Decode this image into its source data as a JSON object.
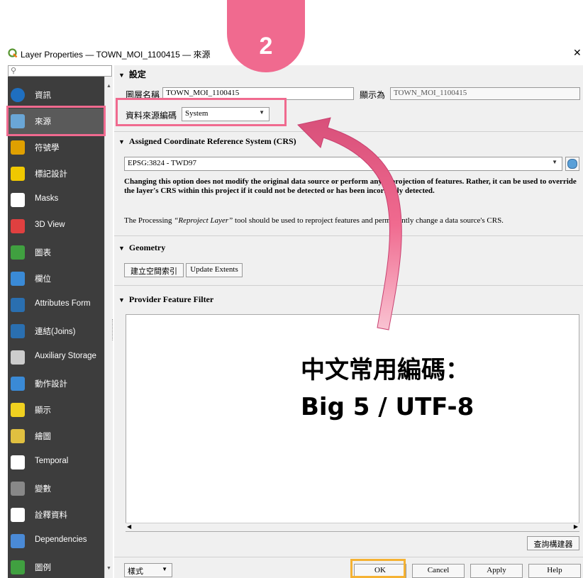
{
  "window": {
    "title": "Layer Properties — TOWN_MOI_1100415 — 來源",
    "close_glyph": "✕"
  },
  "sidebar": {
    "search_placeholder": "",
    "items": [
      {
        "label": "資訊",
        "icon": "info-icon",
        "color": "#1f6fc0"
      },
      {
        "label": "來源",
        "icon": "source-wrench-icon",
        "color": "#6aa6d6"
      },
      {
        "label": "符號學",
        "icon": "symbology-icon",
        "color": "#e0a000"
      },
      {
        "label": "標記設計",
        "icon": "labels-abc-icon",
        "color": "#f0c800"
      },
      {
        "label": "Masks",
        "icon": "masks-abc-icon",
        "color": "#ffffff"
      },
      {
        "label": "3D View",
        "icon": "cube-3d-icon",
        "color": "#e04040"
      },
      {
        "label": "圖表",
        "icon": "diagram-icon",
        "color": "#40a040"
      },
      {
        "label": "欄位",
        "icon": "fields-icon",
        "color": "#3a8ad6"
      },
      {
        "label": "Attributes Form",
        "icon": "form-icon",
        "color": "#2a6fb0"
      },
      {
        "label": "連結(Joins)",
        "icon": "joins-icon",
        "color": "#2a6fb0"
      },
      {
        "label": "Auxiliary Storage",
        "icon": "storage-icon",
        "color": "#cccccc"
      },
      {
        "label": "動作設計",
        "icon": "actions-gear-icon",
        "color": "#3a8ad6"
      },
      {
        "label": "顯示",
        "icon": "display-bubble-icon",
        "color": "#f0d020"
      },
      {
        "label": "繪圖",
        "icon": "rendering-brush-icon",
        "color": "#e0c040"
      },
      {
        "label": "Temporal",
        "icon": "clock-icon",
        "color": "#ffffff"
      },
      {
        "label": "變數",
        "icon": "variables-icon",
        "color": "#888888"
      },
      {
        "label": "詮釋資料",
        "icon": "metadata-icon",
        "color": "#ffffff"
      },
      {
        "label": "Dependencies",
        "icon": "dependencies-icon",
        "color": "#4a8ad6"
      },
      {
        "label": "圖例",
        "icon": "legend-icon",
        "color": "#40a040"
      }
    ]
  },
  "settings": {
    "header": "設定",
    "layer_name_label": "圖層名稱",
    "layer_name_value": "TOWN_MOI_1100415",
    "display_as_label": "顯示為",
    "display_as_value": "TOWN_MOI_1100415",
    "encoding_label": "資料來源編碼",
    "encoding_value": "System"
  },
  "crs": {
    "header": "Assigned Coordinate Reference System (CRS)",
    "value": "EPSG:3824 - TWD97",
    "warning": "Changing this option does not modify the original data source or perform any reprojection of features. Rather, it can be used to override the layer's CRS within this project if it could not be detected or has been incorrectly detected.",
    "note_prefix": "The Processing",
    "note_tool": "“Reproject Layer”",
    "note_suffix": "tool should be used to reproject features and permanently change a data source's CRS."
  },
  "geometry": {
    "header": "Geometry",
    "create_index_label": "建立空間索引",
    "update_extents_label": "Update Extents"
  },
  "filter": {
    "header": "Provider Feature Filter",
    "query_builder_label": "查詢構建器"
  },
  "footer": {
    "style_label": "樣式",
    "ok_label": "OK",
    "cancel_label": "Cancel",
    "apply_label": "Apply",
    "help_label": "Help"
  },
  "overlay": {
    "step_number": "2",
    "annotation_line1": "中文常用編碼：",
    "annotation_line2": "Big 5 / UTF-8",
    "highlight_color": "#f06a8f",
    "ok_highlight_color": "#f5b233"
  }
}
